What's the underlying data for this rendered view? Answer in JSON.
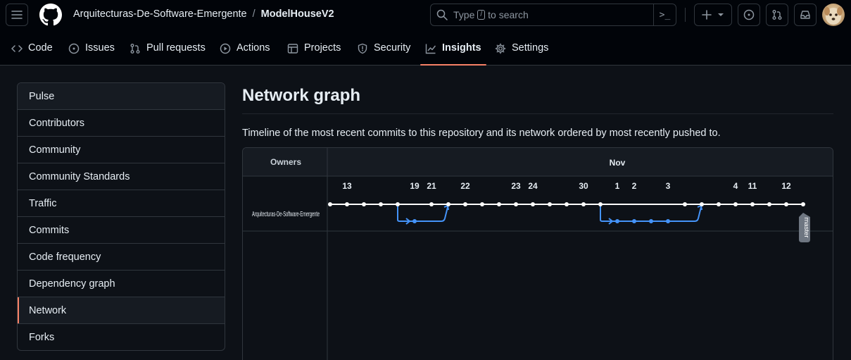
{
  "header": {
    "owner": "Arquitecturas-De-Software-Emergente",
    "separator": "/",
    "repo": "ModelHouseV2",
    "search": {
      "prefix": "Type",
      "key": "/",
      "suffix": "to search"
    }
  },
  "tabs": [
    {
      "label": "Code",
      "icon": "code-icon"
    },
    {
      "label": "Issues",
      "icon": "issue-opened-icon"
    },
    {
      "label": "Pull requests",
      "icon": "git-pull-request-icon"
    },
    {
      "label": "Actions",
      "icon": "play-icon"
    },
    {
      "label": "Projects",
      "icon": "table-icon"
    },
    {
      "label": "Security",
      "icon": "shield-icon"
    },
    {
      "label": "Insights",
      "icon": "graph-icon",
      "active": true
    },
    {
      "label": "Settings",
      "icon": "gear-icon"
    }
  ],
  "sidebar": {
    "items": [
      {
        "label": "Pulse"
      },
      {
        "label": "Contributors"
      },
      {
        "label": "Community"
      },
      {
        "label": "Community Standards"
      },
      {
        "label": "Traffic"
      },
      {
        "label": "Commits"
      },
      {
        "label": "Code frequency"
      },
      {
        "label": "Dependency graph"
      },
      {
        "label": "Network",
        "active": true
      },
      {
        "label": "Forks"
      }
    ]
  },
  "main": {
    "title": "Network graph",
    "description": "Timeline of the most recent commits to this repository and its network ordered by most recently pushed to."
  },
  "network": {
    "owners_header": "Owners",
    "month_label": "Nov",
    "owner_name": "Arquitecturas-De-Software-Emergente",
    "branch_label": "master",
    "day_labels": [
      "13",
      "19",
      "21",
      "22",
      "23",
      "24",
      "30",
      "1",
      "2",
      "3",
      "4",
      "11",
      "12"
    ],
    "colors": {
      "main_line": "#ffffff",
      "branch_line": "#4493f8"
    }
  }
}
